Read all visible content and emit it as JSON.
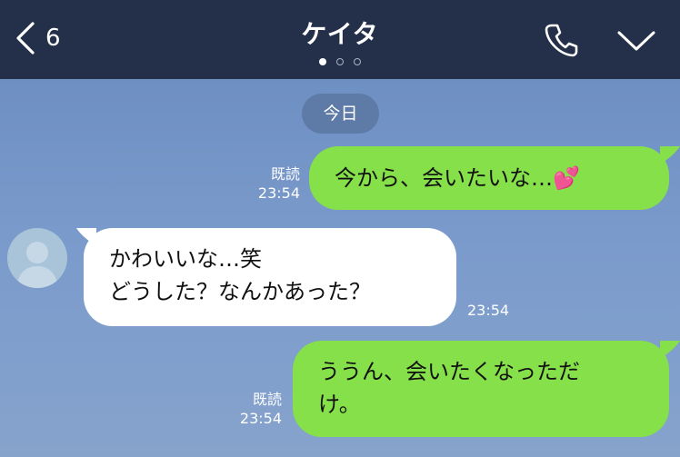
{
  "header": {
    "back_count": "6",
    "title": "ケイタ",
    "page_dots": [
      "active",
      "inactive",
      "inactive"
    ]
  },
  "icons": {
    "back": "chevron-left-icon",
    "call": "phone-icon",
    "menu": "chevron-down-icon"
  },
  "chat": {
    "date_label": "今日",
    "messages": [
      {
        "side": "sent",
        "text": "今から、会いたいな…",
        "emoji": "💕",
        "read_label": "既読",
        "time": "23:54"
      },
      {
        "side": "received",
        "lines": [
          "かわいいな…笑",
          "どうした？なんかあった？"
        ],
        "time": "23:54"
      },
      {
        "side": "sent",
        "lines": [
          "ううん、会いたくなっただ",
          "け。"
        ],
        "read_label": "既読",
        "time": "23:54"
      }
    ]
  },
  "colors": {
    "header_bg": "#24304a",
    "chat_bg": "#7b9bc9",
    "sent_bubble": "#86e04a",
    "received_bubble": "#ffffff",
    "date_chip": "#5e7ba8"
  }
}
